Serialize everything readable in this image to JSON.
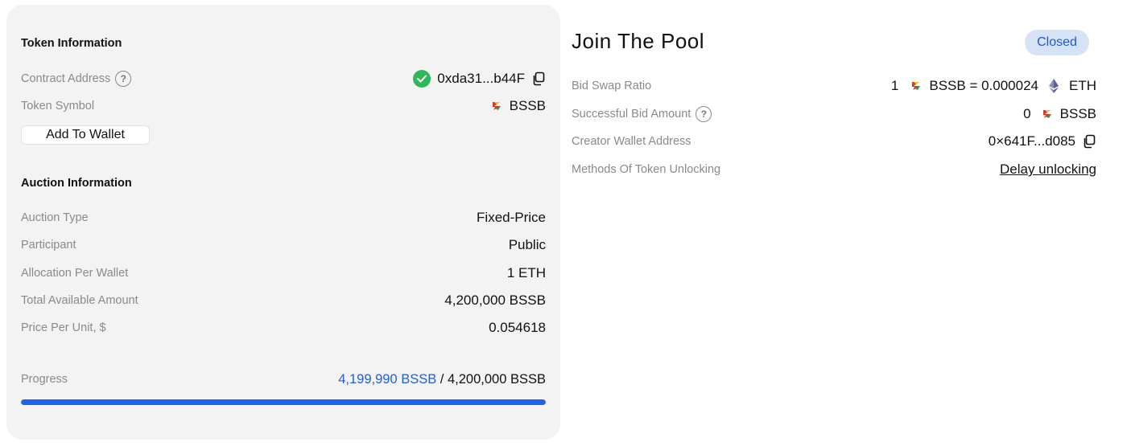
{
  "token_info": {
    "title": "Token Information",
    "contract_address_label": "Contract Address",
    "contract_address": "0xda31...b44F",
    "token_symbol_label": "Token Symbol",
    "token_symbol": "BSSB",
    "add_to_wallet": "Add To Wallet"
  },
  "auction_info": {
    "title": "Auction Information",
    "rows": [
      {
        "label": "Auction Type",
        "value": "Fixed-Price"
      },
      {
        "label": "Participant",
        "value": "Public"
      },
      {
        "label": "Allocation Per Wallet",
        "value": "1 ETH"
      },
      {
        "label": "Total Available Amount",
        "value": "4,200,000 BSSB"
      },
      {
        "label": "Price Per Unit, $",
        "value": "0.054618"
      }
    ]
  },
  "progress": {
    "label": "Progress",
    "current": "4,199,990 BSSB",
    "separator": " / ",
    "total": "4,200,000 BSSB",
    "fraction": 0.99999
  },
  "pool": {
    "title": "Join The Pool",
    "status": "Closed",
    "bid_swap_ratio_label": "Bid Swap Ratio",
    "bid_swap_left": "1",
    "bid_swap_mid": "BSSB = 0.000024",
    "bid_swap_right": "ETH",
    "successful_bid_label": "Successful Bid Amount",
    "successful_bid_amount": "0",
    "successful_bid_token": "BSSB",
    "creator_wallet_label": "Creator Wallet Address",
    "creator_wallet": "0×641F...d085",
    "unlock_methods_label": "Methods Of Token Unlocking",
    "unlock_methods_value": "Delay unlocking"
  },
  "colors": {
    "accent": "#2162e8",
    "badge_bg": "#d6e2f6",
    "badge_text": "#2158c9",
    "verified": "#2eb85c"
  }
}
